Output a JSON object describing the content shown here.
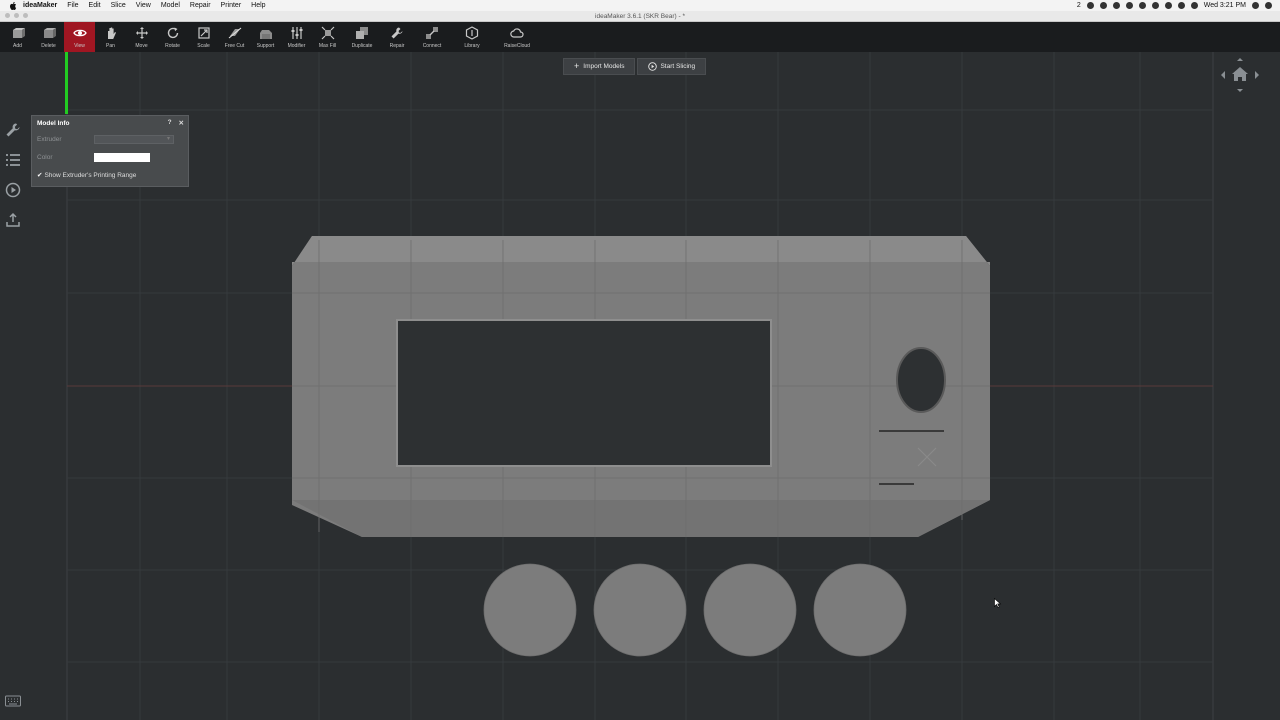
{
  "menubar": {
    "app_name": "ideaMaker",
    "items": [
      "File",
      "Edit",
      "Slice",
      "View",
      "Model",
      "Repair",
      "Printer",
      "Help"
    ],
    "clock": "Wed 3:21 PM",
    "badge_count": "2"
  },
  "window": {
    "title": "ideaMaker 3.6.1 (SKR Bear) - *"
  },
  "toolbar": {
    "tools": [
      {
        "label": "Add",
        "icon": "add-icon",
        "active": false
      },
      {
        "label": "Delete",
        "icon": "delete-icon",
        "active": false
      },
      {
        "label": "View",
        "icon": "eye-icon",
        "active": true
      },
      {
        "label": "Pan",
        "icon": "hand-icon",
        "active": false
      },
      {
        "label": "Move",
        "icon": "move-icon",
        "active": false
      },
      {
        "label": "Rotate",
        "icon": "rotate-icon",
        "active": false
      },
      {
        "label": "Scale",
        "icon": "scale-icon",
        "active": false
      },
      {
        "label": "Free Cut",
        "icon": "cut-icon",
        "active": false
      },
      {
        "label": "Support",
        "icon": "support-icon",
        "active": false
      },
      {
        "label": "Modifier",
        "icon": "modifier-icon",
        "active": false
      },
      {
        "label": "Max Fill",
        "icon": "maxfill-icon",
        "active": false
      },
      {
        "label": "Duplicate",
        "icon": "duplicate-icon",
        "active": false
      },
      {
        "label": "Repair",
        "icon": "repair-icon",
        "active": false
      },
      {
        "label": "Connect",
        "icon": "connect-icon",
        "active": false
      },
      {
        "label": "Library",
        "icon": "library-icon",
        "active": false
      },
      {
        "label": "RaiseCloud",
        "icon": "cloud-icon",
        "active": false
      }
    ]
  },
  "actions": {
    "import_label": "Import Models",
    "slice_label": "Start Slicing"
  },
  "model_info": {
    "title": "Model Info",
    "help": "?",
    "close": "✕",
    "extruder_label": "Extruder",
    "extruder_value": "",
    "color_label": "Color",
    "color_value": "#ffffff",
    "show_range_label": "Show Extruder's Printing Range",
    "show_range_checked": true
  },
  "colors": {
    "background": "#2b2e30",
    "grid": "#3a3e41",
    "model": "#7a7a7a",
    "accent_active": "#a01622",
    "axis_y": "#22cc22"
  }
}
